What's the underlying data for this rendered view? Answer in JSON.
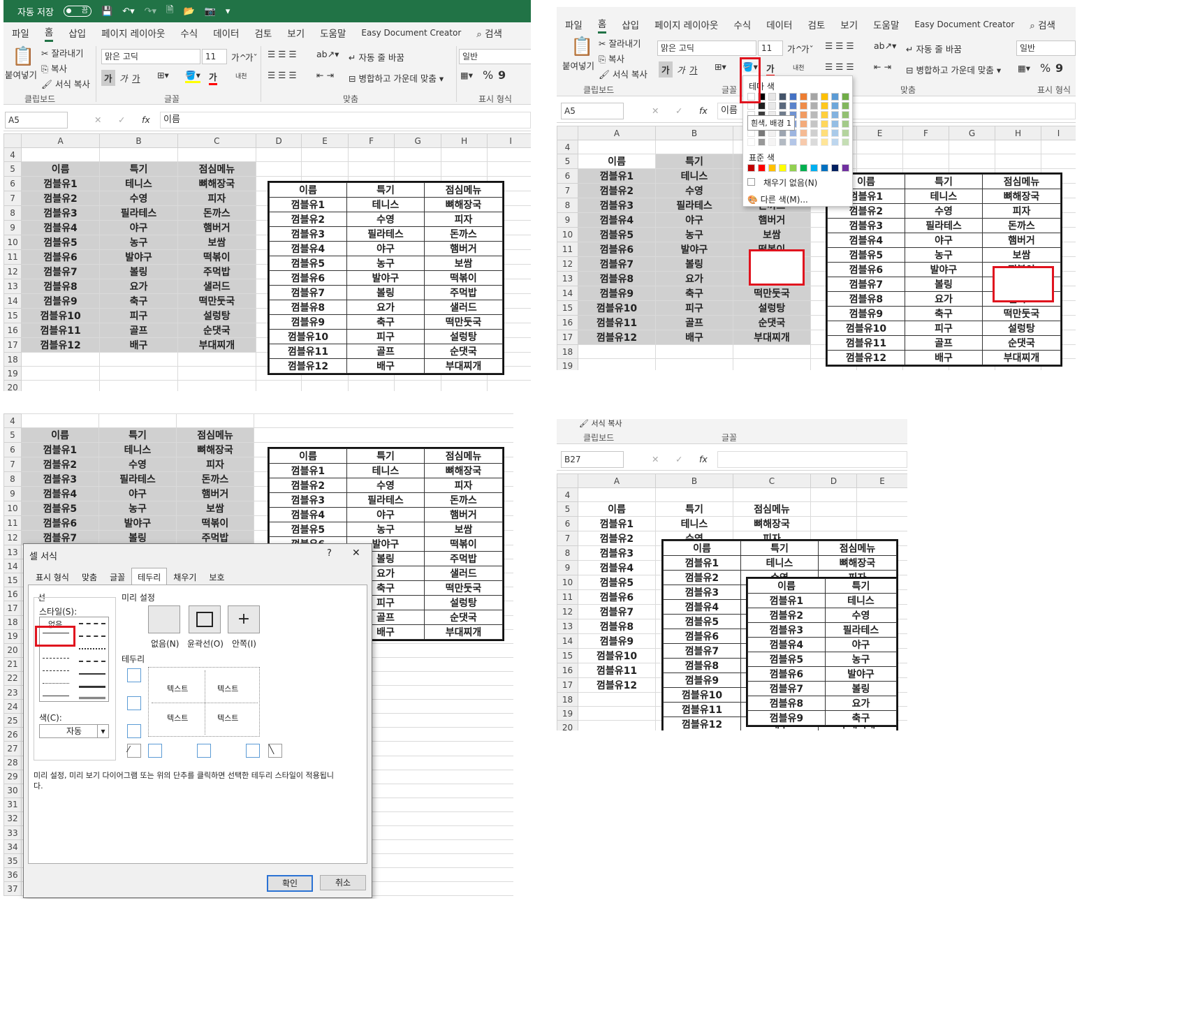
{
  "excel": {
    "autosave_label": "자동 저장",
    "autosave_state": "끔",
    "menu": [
      "파일",
      "홈",
      "삽입",
      "페이지 레이아웃",
      "수식",
      "데이터",
      "검토",
      "보기",
      "도움말",
      "Easy Document Creator",
      "검색"
    ],
    "clipboard": {
      "paste": "붙여넣기",
      "cut": "잘라내기",
      "copy": "복사",
      "format_painter": "서식 복사",
      "group": "클립보드"
    },
    "font": {
      "name": "맑은 고딕",
      "size": "11",
      "group": "글꼴",
      "bold": "가",
      "italic": "가",
      "underline": "가",
      "grow": "가^",
      "shrink": "가ˇ",
      "font_color": "가",
      "phonetic": "내천"
    },
    "align": {
      "wrap": "자동 줄 바꿈",
      "merge": "병합하고 가운데 맞춤",
      "group": "맞춤"
    },
    "number": {
      "format": "일반",
      "group": "표시 형식",
      "percent": "%",
      "comma": "9"
    },
    "fx": "fx"
  },
  "columns_main": [
    "A",
    "B",
    "C",
    "D",
    "E",
    "F",
    "G",
    "H",
    "I"
  ],
  "columns_p2": [
    "A",
    "B",
    "C",
    "D",
    "E",
    "F",
    "G",
    "H",
    "I"
  ],
  "columns_p4": [
    "A",
    "B",
    "C",
    "D",
    "E"
  ],
  "table": {
    "headers": [
      "이름",
      "특기",
      "점심메뉴"
    ],
    "rows": [
      [
        "껌블유1",
        "테니스",
        "뼈해장국"
      ],
      [
        "껌블유2",
        "수영",
        "피자"
      ],
      [
        "껌블유3",
        "필라테스",
        "돈까스"
      ],
      [
        "껌블유4",
        "야구",
        "햄버거"
      ],
      [
        "껌블유5",
        "농구",
        "보쌈"
      ],
      [
        "껌블유6",
        "발야구",
        "떡볶이"
      ],
      [
        "껌블유7",
        "볼링",
        "주먹밥"
      ],
      [
        "껌블유8",
        "요가",
        "샐러드"
      ],
      [
        "껌블유9",
        "축구",
        "떡만둣국"
      ],
      [
        "껌블유10",
        "피구",
        "설렁탕"
      ],
      [
        "껌블유11",
        "골프",
        "순댓국"
      ],
      [
        "껌블유12",
        "배구",
        "부대찌개"
      ]
    ]
  },
  "panel1": {
    "namebox": "A5",
    "formula": "이름",
    "rows": [
      "4",
      "5",
      "6",
      "7",
      "8",
      "9",
      "10",
      "11",
      "12",
      "13",
      "14",
      "15",
      "16",
      "17",
      "18",
      "19",
      "20"
    ]
  },
  "panel2": {
    "namebox": "A5",
    "formula": "이름",
    "rows": [
      "4",
      "5",
      "6",
      "7",
      "8",
      "9",
      "10",
      "11",
      "12",
      "13",
      "14",
      "15",
      "16",
      "17",
      "18",
      "19"
    ],
    "popup": {
      "theme_colors": "테마 색",
      "tooltip": "흰색, 배경 1",
      "standard_colors": "표준 색",
      "no_fill": "채우기 없음(N)",
      "more_colors": "다른 색(M)..."
    },
    "theme_swatches": [
      "#ffffff",
      "#000000",
      "#e7e6e6",
      "#44546a",
      "#4472c4",
      "#ed7d31",
      "#a5a5a5",
      "#ffc000",
      "#5b9bd5",
      "#70ad47"
    ],
    "standard_swatches": [
      "#c00000",
      "#ff0000",
      "#ffc000",
      "#ffff00",
      "#92d050",
      "#00b050",
      "#00b0f0",
      "#0070c0",
      "#002060",
      "#7030a0"
    ]
  },
  "panel3": {
    "rows": [
      "4",
      "5",
      "6",
      "7",
      "8",
      "9",
      "10",
      "11",
      "12",
      "13",
      "14",
      "15",
      "16",
      "17",
      "18",
      "19",
      "20",
      "21",
      "22",
      "23",
      "24",
      "25",
      "26",
      "27",
      "28",
      "29",
      "30",
      "31",
      "32",
      "33",
      "34",
      "35",
      "36",
      "37"
    ],
    "dialog": {
      "title": "셀 서식",
      "help": "?",
      "close": "✕",
      "tabs": [
        "표시 형식",
        "맞춤",
        "글꼴",
        "테두리",
        "채우기",
        "보호"
      ],
      "active_tab": "테두리",
      "line": "선",
      "style": "스타일(S):",
      "none_style": "없음",
      "color": "색(C):",
      "color_value": "자동",
      "presets": "미리 설정",
      "preset_none": "없음(N)",
      "preset_outline": "윤곽선(O)",
      "preset_inside": "안쪽(I)",
      "border": "테두리",
      "preview_text": "텍스트",
      "hint": "미리 설정, 미리 보기 다이어그램 또는 위의 단추를 클릭하면 선택한 테두리 스타일이 적용됩니다.",
      "ok": "확인",
      "cancel": "취소"
    }
  },
  "panel4": {
    "namebox": "B27",
    "group_clipboard": "클립보드",
    "group_font": "글꼴",
    "format_painter": "서식 복사",
    "rows": [
      "4",
      "5",
      "6",
      "7",
      "8",
      "9",
      "10",
      "11",
      "12",
      "13",
      "14",
      "15",
      "16",
      "17",
      "18",
      "19",
      "20"
    ]
  }
}
